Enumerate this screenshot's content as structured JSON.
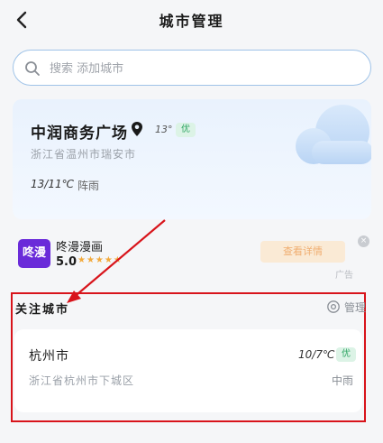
{
  "header": {
    "title": "城市管理"
  },
  "search": {
    "placeholder": "搜索 添加城市"
  },
  "current_location": {
    "name": "中润商务广场",
    "temperature": "13°",
    "aqi": "优",
    "region": "浙江省温州市瑞安市",
    "temp_range": "13/11℃",
    "weather": "阵雨"
  },
  "ad": {
    "logo_text": "咚漫",
    "name": "咚漫漫画",
    "rating": "5.0",
    "stars": "★★★★★",
    "cta": "查看详情",
    "label": "广告",
    "close": "×"
  },
  "followed": {
    "title": "关注城市",
    "manage_label": "管理",
    "cities": [
      {
        "name": "杭州市",
        "temp_range": "10/7℃",
        "aqi": "优",
        "region": "浙江省杭州市下城区",
        "weather": "中雨"
      }
    ]
  },
  "colors": {
    "accent": "#9fc3e8",
    "highlight": "#d8141b",
    "aqi_good": "#2fa664",
    "ad_brand": "#6a2bd9"
  },
  "icons": [
    "back-arrow-icon",
    "search-icon",
    "location-pin-icon",
    "cloud-icon",
    "gear-icon",
    "close-icon"
  ]
}
